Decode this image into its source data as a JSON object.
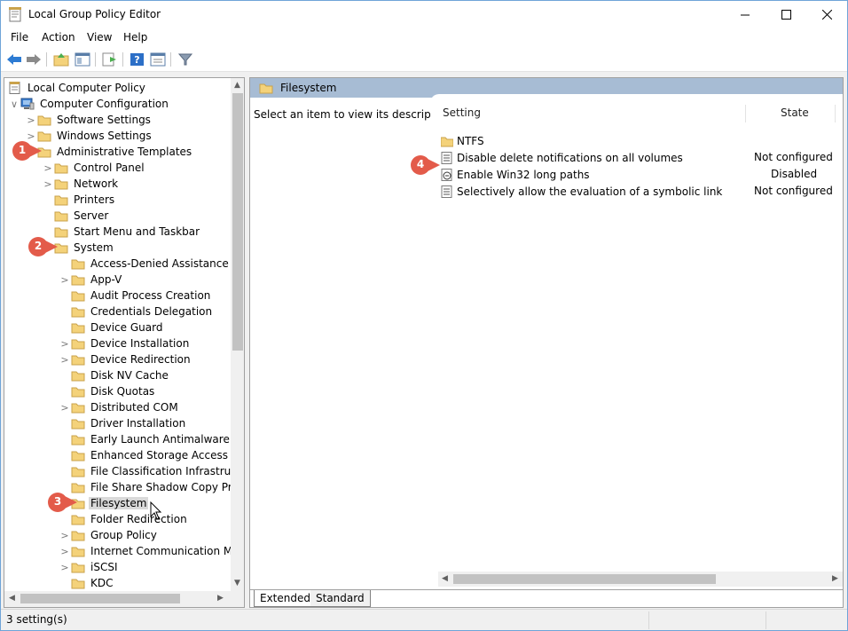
{
  "window": {
    "title": "Local Group Policy Editor",
    "controls": {
      "minimize": "—",
      "maximize": "☐",
      "close": "✕"
    }
  },
  "menu": [
    "File",
    "Action",
    "View",
    "Help"
  ],
  "toolbar": {
    "icons": [
      "back-icon",
      "forward-icon",
      "up-folder-icon",
      "show-hide-tree-icon",
      "export-list-icon",
      "help-icon",
      "properties-icon",
      "filter-icon"
    ]
  },
  "tree": {
    "items": [
      {
        "label": "Local Computer Policy",
        "level": 0,
        "arrow": ""
      },
      {
        "label": "Computer Configuration",
        "level": 0,
        "arrow": "∨"
      },
      {
        "label": "Software Settings",
        "level": 1,
        "arrow": ">"
      },
      {
        "label": "Windows Settings",
        "level": 1,
        "arrow": ">"
      },
      {
        "label": "Administrative Templates",
        "level": 1,
        "arrow": "∨"
      },
      {
        "label": "Control Panel",
        "level": 2,
        "arrow": ">"
      },
      {
        "label": "Network",
        "level": 2,
        "arrow": ">"
      },
      {
        "label": "Printers",
        "level": 2,
        "arrow": ""
      },
      {
        "label": "Server",
        "level": 2,
        "arrow": ""
      },
      {
        "label": "Start Menu and Taskbar",
        "level": 2,
        "arrow": ""
      },
      {
        "label": "System",
        "level": 2,
        "arrow": "∨"
      },
      {
        "label": "Access-Denied Assistance",
        "level": 3,
        "arrow": ""
      },
      {
        "label": "App-V",
        "level": 3,
        "arrow": ">"
      },
      {
        "label": "Audit Process Creation",
        "level": 3,
        "arrow": ""
      },
      {
        "label": "Credentials Delegation",
        "level": 3,
        "arrow": ""
      },
      {
        "label": "Device Guard",
        "level": 3,
        "arrow": ""
      },
      {
        "label": "Device Installation",
        "level": 3,
        "arrow": ">"
      },
      {
        "label": "Device Redirection",
        "level": 3,
        "arrow": ">"
      },
      {
        "label": "Disk NV Cache",
        "level": 3,
        "arrow": ""
      },
      {
        "label": "Disk Quotas",
        "level": 3,
        "arrow": ""
      },
      {
        "label": "Distributed COM",
        "level": 3,
        "arrow": ">"
      },
      {
        "label": "Driver Installation",
        "level": 3,
        "arrow": ""
      },
      {
        "label": "Early Launch Antimalware",
        "level": 3,
        "arrow": ""
      },
      {
        "label": "Enhanced Storage Access",
        "level": 3,
        "arrow": ""
      },
      {
        "label": "File Classification Infrastruct",
        "level": 3,
        "arrow": ""
      },
      {
        "label": "File Share Shadow Copy Pro",
        "level": 3,
        "arrow": ""
      },
      {
        "label": "Filesystem",
        "level": 3,
        "arrow": "",
        "selected": true
      },
      {
        "label": "Folder Redirection",
        "level": 3,
        "arrow": ""
      },
      {
        "label": "Group Policy",
        "level": 3,
        "arrow": ">"
      },
      {
        "label": "Internet Communication Ma",
        "level": 3,
        "arrow": ">"
      },
      {
        "label": "iSCSI",
        "level": 3,
        "arrow": ">"
      },
      {
        "label": "KDC",
        "level": 3,
        "arrow": ""
      }
    ]
  },
  "right": {
    "header": "Filesystem",
    "description": "Select an item to view its description.",
    "columns": {
      "setting": "Setting",
      "state": "State"
    },
    "rows": [
      {
        "setting": "NTFS",
        "state": "",
        "icon": "folder-icon"
      },
      {
        "setting": "Disable delete notifications on all volumes",
        "state": "Not configured",
        "icon": "policy-setting-icon"
      },
      {
        "setting": "Enable Win32 long paths",
        "state": "Disabled",
        "icon": "policy-disabled-icon"
      },
      {
        "setting": "Selectively allow the evaluation of a symbolic link",
        "state": "Not configured",
        "icon": "policy-setting-icon"
      }
    ],
    "tabs": [
      "Extended",
      "Standard"
    ]
  },
  "status": "3 setting(s)",
  "callouts": [
    "1",
    "2",
    "3",
    "4"
  ],
  "colors": {
    "header_bg": "#a7bcd4",
    "callout": "#e35b4a",
    "folder": "#f4d27a",
    "selection": "#d9d9d9"
  }
}
